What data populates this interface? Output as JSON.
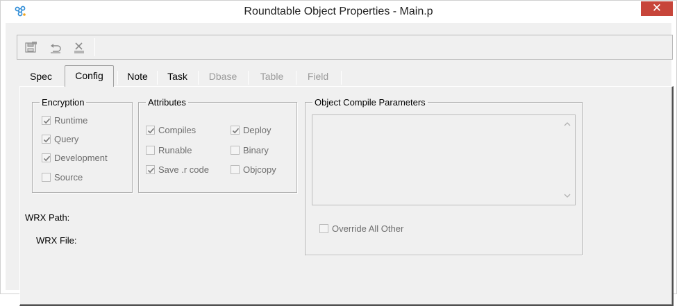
{
  "window": {
    "title": "Roundtable Object Properties - Main.p",
    "close_symbol": "✕",
    "app_icon": "roundtable-app-icon"
  },
  "toolbar": {
    "buttons": [
      {
        "name": "save-icon",
        "enabled": false
      },
      {
        "name": "undo-icon",
        "enabled": false
      },
      {
        "name": "delete-icon",
        "enabled": false
      }
    ]
  },
  "tabs": [
    {
      "label": "Spec",
      "state": "enabled"
    },
    {
      "label": "Config",
      "state": "active"
    },
    {
      "label": "Note",
      "state": "enabled"
    },
    {
      "label": "Task",
      "state": "enabled"
    },
    {
      "label": "Dbase",
      "state": "disabled"
    },
    {
      "label": "Table",
      "state": "disabled"
    },
    {
      "label": "Field",
      "state": "disabled"
    }
  ],
  "encryption": {
    "legend": "Encryption",
    "items": [
      {
        "label": "Runtime",
        "checked": true
      },
      {
        "label": "Query",
        "checked": true
      },
      {
        "label": "Development",
        "checked": true
      },
      {
        "label": "Source",
        "checked": false
      }
    ]
  },
  "attributes": {
    "legend": "Attributes",
    "items": [
      {
        "label": "Compiles",
        "checked": true
      },
      {
        "label": "Deploy",
        "checked": true
      },
      {
        "label": "Runable",
        "checked": false
      },
      {
        "label": "Binary",
        "checked": false
      },
      {
        "label": "Save .r code",
        "checked": true
      },
      {
        "label": "Objcopy",
        "checked": false
      }
    ]
  },
  "compile": {
    "legend": "Object Compile Parameters",
    "parameters_value": "",
    "override_label": "Override All Other",
    "override_checked": false
  },
  "paths": {
    "wrx_path_label": "WRX Path:",
    "wrx_file_label": "WRX File:"
  },
  "colors": {
    "close_button": "#c7453a",
    "face": "#f0f0f0",
    "disabled_text": "#6d6d6d"
  }
}
